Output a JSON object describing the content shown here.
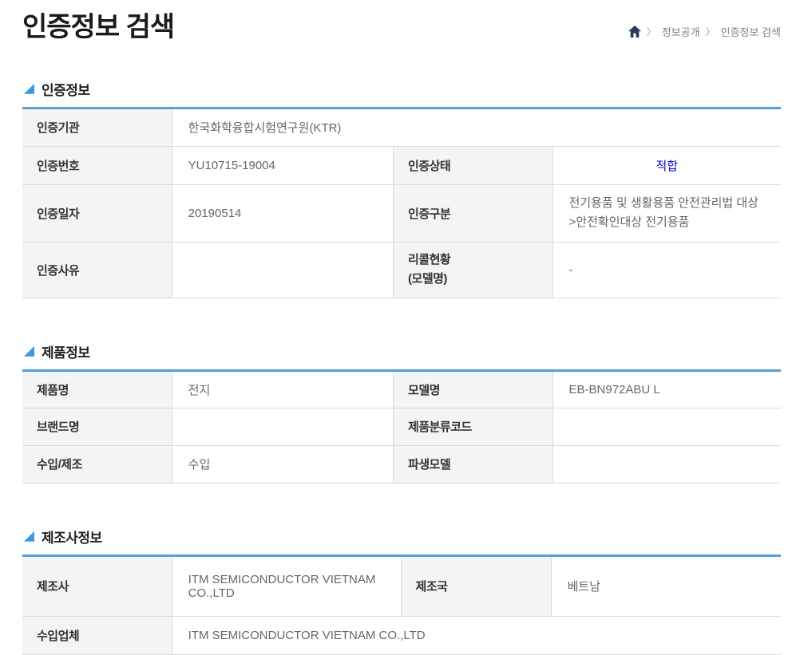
{
  "page_title": "인증정보 검색",
  "breadcrumb": {
    "home_icon": "home-icon",
    "separator": "〉",
    "items": [
      "정보공개",
      "인증정보 검색"
    ]
  },
  "colors": {
    "accent_blue": "#559fd9",
    "marker_blue": "#3d98dc",
    "status_blue": "#0101cd",
    "label_bg": "#f4f4f4",
    "border_gray": "#dcdcdc",
    "navy": "#2a3b5e"
  },
  "sections": [
    {
      "title": "인증정보",
      "rows": [
        {
          "cells": [
            {
              "text": "인증기관"
            },
            {
              "text": "한국화학융합시험연구원(KTR)"
            }
          ]
        },
        {
          "cells": [
            {
              "text": "인증번호"
            },
            {
              "text": "YU10715-19004"
            },
            {
              "text": "인증상태"
            },
            {
              "text": "적합"
            }
          ]
        },
        {
          "cells": [
            {
              "text": "인증일자"
            },
            {
              "text": "20190514"
            },
            {
              "text": "인증구분"
            },
            {
              "text": "전기용품 및 생활용품 안전관리법 대상\n>안전확인대상 전기용품"
            }
          ]
        },
        {
          "cells": [
            {
              "text": "인증사유"
            },
            {
              "text": ""
            },
            {
              "text": "리콜현황\n(모델명)"
            },
            {
              "text": "-"
            }
          ]
        }
      ]
    },
    {
      "title": "제품정보",
      "rows": [
        {
          "cells": [
            {
              "text": "제품명"
            },
            {
              "text": "전지"
            },
            {
              "text": "모델명"
            },
            {
              "text": "EB-BN972ABU L"
            }
          ]
        },
        {
          "cells": [
            {
              "text": "브랜드명"
            },
            {
              "text": ""
            },
            {
              "text": "제품분류코드"
            },
            {
              "text": ""
            }
          ]
        },
        {
          "cells": [
            {
              "text": "수입/제조"
            },
            {
              "text": "수입"
            },
            {
              "text": "파생모델"
            },
            {
              "text": ""
            }
          ]
        }
      ]
    },
    {
      "title": "제조사정보",
      "rows": [
        {
          "cells": [
            {
              "text": "제조사"
            },
            {
              "text": "ITM SEMICONDUCTOR VIETNAM CO.,LTD"
            },
            {
              "text": "제조국"
            },
            {
              "text": "베트남"
            }
          ]
        },
        {
          "cells": [
            {
              "text": "수입업체"
            },
            {
              "text": "ITM SEMICONDUCTOR VIETNAM CO.,LTD"
            }
          ]
        }
      ]
    }
  ]
}
